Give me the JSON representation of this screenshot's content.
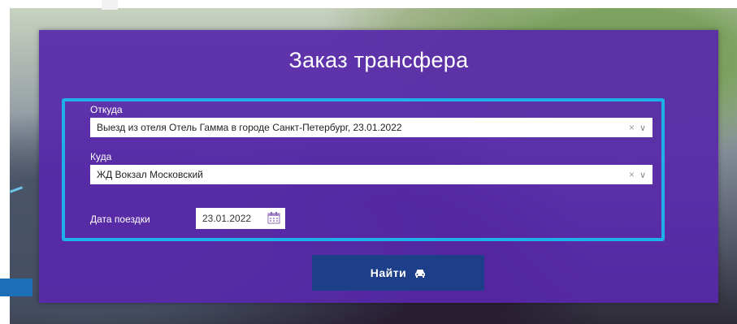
{
  "form": {
    "title": "Заказ трансфера",
    "from_label": "Откуда",
    "from_value": "Выезд из отеля Отель Гамма в городе Санкт-Петербург, 23.01.2022",
    "to_label": "Куда",
    "to_value": "ЖД Вокзал Московский",
    "date_label": "Дата поездки",
    "date_value": "23.01.2022",
    "clear_symbol": "×",
    "chevron_symbol": "∨",
    "submit_label": "Найти",
    "submit_icon": "car-icon",
    "calendar_icon": "calendar-icon"
  },
  "colors": {
    "panel": "#5828aa",
    "frame": "#1fb0ea",
    "button": "#1d3f8a"
  }
}
